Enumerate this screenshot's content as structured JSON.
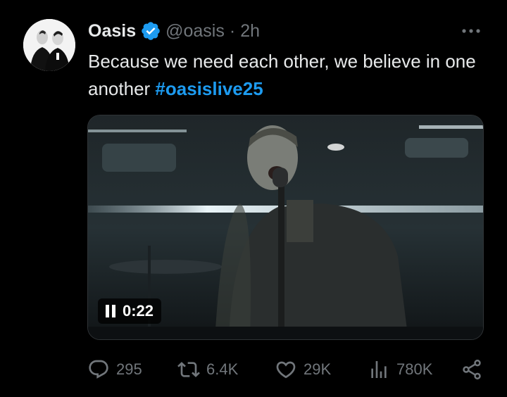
{
  "post": {
    "author_name": "Oasis",
    "handle": "@oasis",
    "separator": "·",
    "time": "2h",
    "text": "Because we need each other, we believe in one another",
    "hashtag": "#oasislive25"
  },
  "video": {
    "elapsed": "0:22",
    "state": "playing"
  },
  "actions": {
    "replies": "295",
    "reposts": "6.4K",
    "likes": "29K",
    "views": "780K"
  },
  "icons": [
    "verified-badge-icon",
    "more-options-icon",
    "pause-icon",
    "reply-icon",
    "repost-icon",
    "like-icon",
    "views-icon",
    "share-icon"
  ],
  "colors": {
    "background": "#000000",
    "text": "#e7e9ea",
    "muted": "#71767b",
    "accent": "#1d9bf0"
  }
}
